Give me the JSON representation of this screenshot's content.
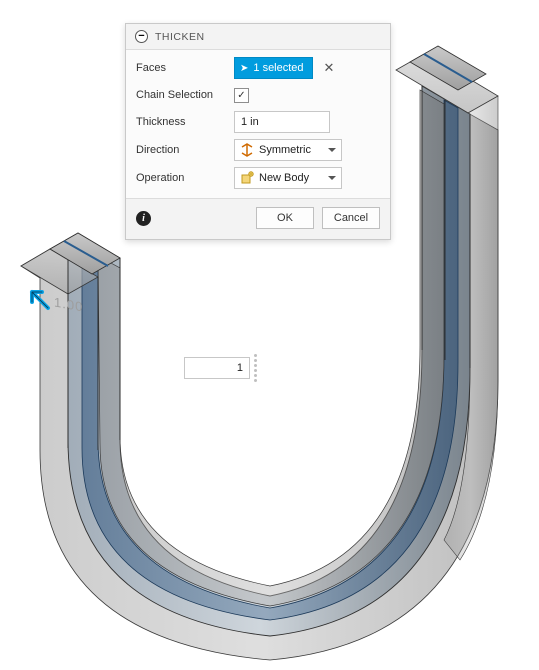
{
  "dialog": {
    "title": "THICKEN",
    "rows": {
      "faces": {
        "label": "Faces",
        "selection": "1 selected"
      },
      "chain": {
        "label": "Chain Selection",
        "checked": true
      },
      "thickness": {
        "label": "Thickness",
        "value": "1 in"
      },
      "direction": {
        "label": "Direction",
        "value": "Symmetric"
      },
      "operation": {
        "label": "Operation",
        "value": "New Body"
      }
    },
    "buttons": {
      "ok": "OK",
      "cancel": "Cancel"
    }
  },
  "inline_value": "1",
  "dimension_label": "1.00",
  "glyphs": {
    "collapse": "−",
    "check": "✓",
    "clear": "✕",
    "cursor": "➤",
    "info": "i"
  }
}
